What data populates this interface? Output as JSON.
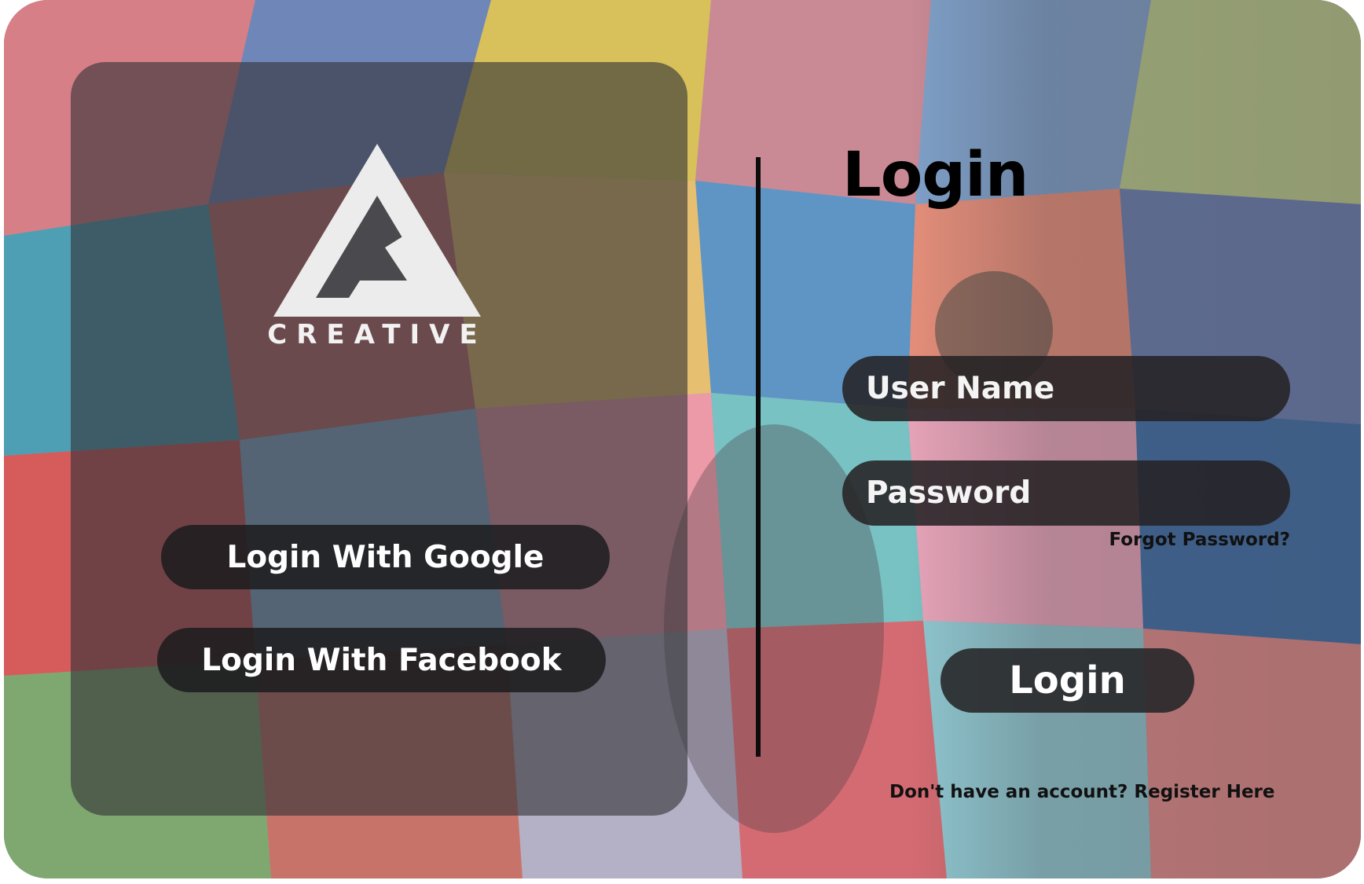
{
  "logo": {
    "icon": "triangle-logo-icon",
    "text": "CREATIVE"
  },
  "social": {
    "google_label": "Login With Google",
    "facebook_label": "Login With Facebook"
  },
  "form": {
    "title": "Login",
    "username_placeholder": "User Name",
    "password_placeholder": "Password",
    "forgot_label": "Forgot Password?",
    "submit_label": "Login",
    "register_prompt": "Don't have an account?",
    "register_link": "Register Here"
  },
  "colors": {
    "panel": "#343438",
    "button": "#1c1c1e",
    "text_light": "#ffffff",
    "text_dark": "#000000"
  }
}
